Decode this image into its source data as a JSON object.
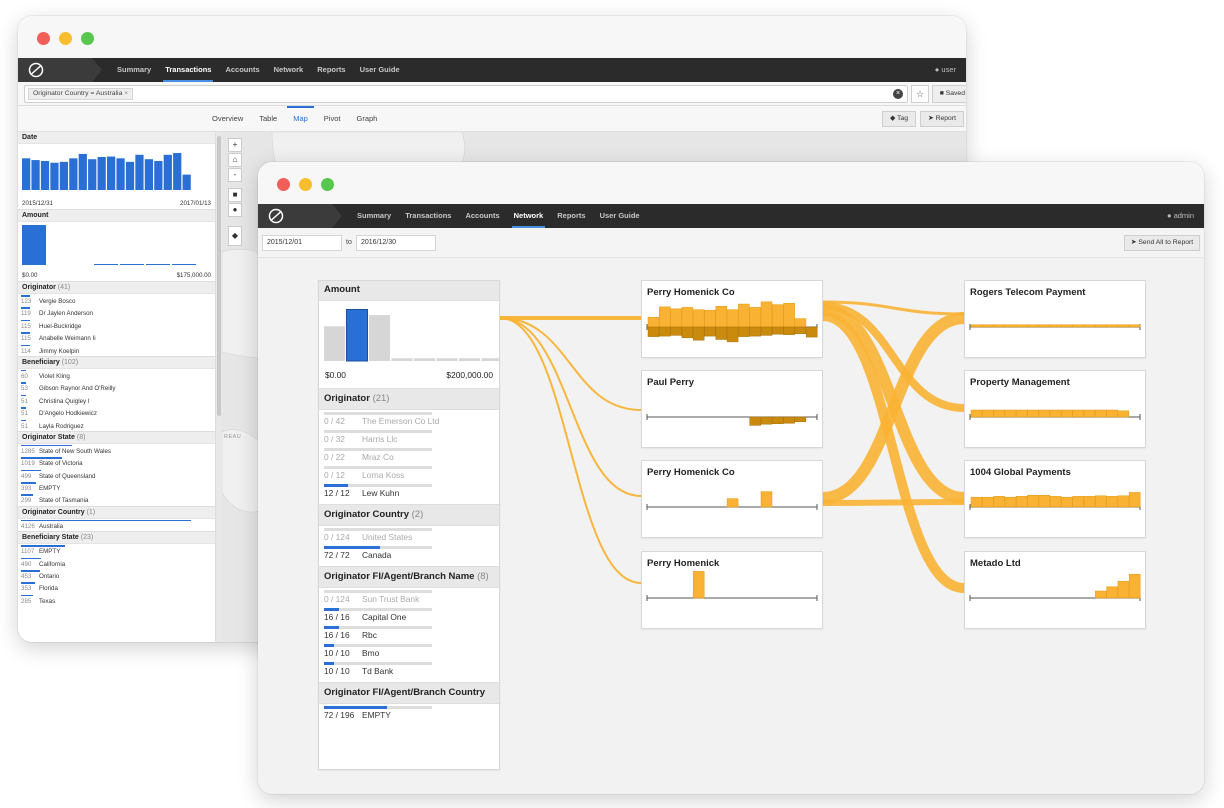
{
  "colors": {
    "accent": "#2a6fd6",
    "flow": "#f9b233",
    "flow_dark": "#c98a0e",
    "nav_bg": "#2b2b2b"
  },
  "back_window": {
    "nav": {
      "tabs": [
        "Summary",
        "Transactions",
        "Accounts",
        "Network",
        "Reports",
        "User Guide"
      ],
      "active": "Transactions",
      "user": "user"
    },
    "filter": {
      "chip": "Originator Country = Australia",
      "saved_label": "Saved"
    },
    "view_tabs": [
      "Overview",
      "Table",
      "Map",
      "Pivot",
      "Graph"
    ],
    "active_view": "Map",
    "tag_label": "Tag",
    "report_label": "Report",
    "sidebar": {
      "date": {
        "title": "Date",
        "start": "2015/12/31",
        "end": "2017/01/13",
        "bars": [
          0.72,
          0.68,
          0.66,
          0.62,
          0.64,
          0.72,
          0.82,
          0.7,
          0.75,
          0.76,
          0.72,
          0.64,
          0.8,
          0.7,
          0.66,
          0.8,
          0.84,
          0.35
        ]
      },
      "amount": {
        "title": "Amount",
        "min": "$0.00",
        "max": "$175,000.00"
      },
      "originator": {
        "title": "Originator",
        "count": "(41)",
        "rows": [
          {
            "n": "123",
            "name": "Vergie Bosco",
            "f": 0.05
          },
          {
            "n": "119",
            "name": "Dr Jaylen Anderson",
            "f": 0.05
          },
          {
            "n": "115",
            "name": "Huel-Buckridge",
            "f": 0.05
          },
          {
            "n": "115",
            "name": "Anabelle Weimann Ii",
            "f": 0.05
          },
          {
            "n": "114",
            "name": "Jimmy Koelpin",
            "f": 0.05
          }
        ]
      },
      "beneficiary": {
        "title": "Beneficiary",
        "count": "(102)",
        "rows": [
          {
            "n": "60",
            "name": "Violet Kling",
            "f": 0.03
          },
          {
            "n": "53",
            "name": "Gibson Raynor And O'Reilly",
            "f": 0.03
          },
          {
            "n": "51",
            "name": "Christina Quigley I",
            "f": 0.03
          },
          {
            "n": "51",
            "name": "D'Angelo Hodkiewicz",
            "f": 0.03
          },
          {
            "n": "51",
            "name": "Layla Rodriguez",
            "f": 0.03
          }
        ]
      },
      "orig_state": {
        "title": "Originator State",
        "count": "(8)",
        "rows": [
          {
            "n": "1285",
            "name": "State of New South Wales",
            "f": 0.3
          },
          {
            "n": "1019",
            "name": "State of Victoria",
            "f": 0.24
          },
          {
            "n": "499",
            "name": "State of Queensland",
            "f": 0.12
          },
          {
            "n": "393",
            "name": "EMPTY",
            "f": 0.09
          },
          {
            "n": "299",
            "name": "State of Tasmania",
            "f": 0.07
          }
        ]
      },
      "orig_country": {
        "title": "Originator Country",
        "count": "(1)",
        "rows": [
          {
            "n": "4126",
            "name": "Australia",
            "f": 1.0
          }
        ]
      },
      "ben_state": {
        "title": "Beneficiary State",
        "count": "(23)",
        "rows": [
          {
            "n": "1107",
            "name": "EMPTY",
            "f": 0.26
          },
          {
            "n": "490",
            "name": "California",
            "f": 0.12
          },
          {
            "n": "453",
            "name": "Ontario",
            "f": 0.11
          },
          {
            "n": "353",
            "name": "Florida",
            "f": 0.08
          },
          {
            "n": "285",
            "name": "Texas",
            "f": 0.07
          }
        ]
      }
    },
    "map": {
      "label": "REAU"
    }
  },
  "front_window": {
    "nav": {
      "tabs": [
        "Summary",
        "Transactions",
        "Accounts",
        "Network",
        "Reports",
        "User Guide"
      ],
      "active": "Network",
      "user": "admin"
    },
    "date_from": "2015/12/01",
    "date_to_label": "to",
    "date_to": "2016/12/30",
    "send_label": "Send All to Report",
    "filters": {
      "amount": {
        "title": "Amount",
        "min": "$0.00",
        "max": "$200,000.00",
        "bars": [
          0.62,
          0.92,
          0.82,
          0.05,
          0.05,
          0.05,
          0.05,
          0.05
        ],
        "selected_index": 1
      },
      "originator": {
        "title": "Originator",
        "count": "(21)",
        "rows": [
          {
            "n": "0 / 42",
            "name": "The Emerson Co Ltd",
            "f": 0.0,
            "dim": true
          },
          {
            "n": "0 / 32",
            "name": "Harris Llc",
            "f": 0.0,
            "dim": true
          },
          {
            "n": "0 / 22",
            "name": "Mraz Co",
            "f": 0.0,
            "dim": true
          },
          {
            "n": "0 / 12",
            "name": "Lorna Koss",
            "f": 0.0,
            "dim": true
          },
          {
            "n": "12 / 12",
            "name": "Lew Kuhn",
            "f": 0.14,
            "dim": false
          }
        ]
      },
      "orig_country": {
        "title": "Originator Country",
        "count": "(2)",
        "rows": [
          {
            "n": "0 / 124",
            "name": "United States",
            "f": 0.0,
            "dim": true
          },
          {
            "n": "72 / 72",
            "name": "Canada",
            "f": 0.33,
            "dim": false
          }
        ]
      },
      "orig_fi": {
        "title": "Originator FI/Agent/Branch Name",
        "count": "(8)",
        "rows": [
          {
            "n": "0 / 124",
            "name": "Sun Trust Bank",
            "f": 0.0,
            "dim": true
          },
          {
            "n": "16 / 16",
            "name": "Capital One",
            "f": 0.09,
            "dim": false
          },
          {
            "n": "16 / 16",
            "name": "Rbc",
            "f": 0.09,
            "dim": false
          },
          {
            "n": "10 / 10",
            "name": "Bmo",
            "f": 0.06,
            "dim": false
          },
          {
            "n": "10 / 10",
            "name": "Td Bank",
            "f": 0.06,
            "dim": false
          }
        ]
      },
      "orig_fi_country": {
        "title": "Originator FI/Agent/Branch Country",
        "rows": [
          {
            "n": "72 / 196",
            "name": "EMPTY",
            "f": 0.37,
            "dim": false
          }
        ]
      }
    },
    "middle_nodes": [
      {
        "name": "Perry Homenick Co",
        "up": [
          0.35,
          0.72,
          0.65,
          0.7,
          0.62,
          0.6,
          0.74,
          0.62,
          0.82,
          0.7,
          0.9,
          0.8,
          0.85,
          0.3,
          0.0
        ],
        "down": [
          0.4,
          0.38,
          0.35,
          0.45,
          0.55,
          0.38,
          0.52,
          0.62,
          0.4,
          0.38,
          0.35,
          0.3,
          0.32,
          0.28,
          0.42
        ]
      },
      {
        "name": "Paul Perry",
        "up": [
          0,
          0,
          0,
          0,
          0,
          0,
          0,
          0,
          0,
          0,
          0,
          0,
          0,
          0,
          0
        ],
        "down": [
          0,
          0,
          0,
          0,
          0,
          0,
          0,
          0,
          0,
          0.35,
          0.3,
          0.28,
          0.26,
          0.2,
          0
        ]
      },
      {
        "name": "Perry Homenick Co",
        "up": [
          0,
          0,
          0,
          0,
          0,
          0,
          0,
          0.3,
          0,
          0,
          0.55,
          0,
          0,
          0,
          0
        ],
        "down": [
          0,
          0,
          0,
          0,
          0,
          0,
          0,
          0,
          0,
          0,
          0,
          0,
          0,
          0,
          0
        ]
      },
      {
        "name": "Perry Homenick",
        "up": [
          0,
          0,
          0,
          0,
          0.95,
          0,
          0,
          0,
          0,
          0,
          0,
          0,
          0,
          0,
          0
        ],
        "down": [
          0,
          0,
          0,
          0,
          0,
          0,
          0,
          0,
          0,
          0,
          0,
          0,
          0,
          0,
          0
        ]
      }
    ],
    "right_nodes": [
      {
        "name": "Rogers Telecom Payment",
        "up": [
          0.08,
          0.08,
          0.08,
          0.08,
          0.08,
          0.08,
          0.08,
          0.08,
          0.08,
          0.08,
          0.08,
          0.08,
          0.08,
          0.08,
          0.08
        ]
      },
      {
        "name": "Property Management",
        "up": [
          0.25,
          0.25,
          0.25,
          0.25,
          0.25,
          0.25,
          0.25,
          0.25,
          0.25,
          0.25,
          0.25,
          0.25,
          0.25,
          0.22,
          0
        ]
      },
      {
        "name": "1004 Global Payments",
        "up": [
          0.35,
          0.35,
          0.38,
          0.35,
          0.38,
          0.42,
          0.42,
          0.38,
          0.35,
          0.38,
          0.38,
          0.4,
          0.38,
          0.4,
          0.52
        ]
      },
      {
        "name": "Metado Ltd",
        "up": [
          0,
          0,
          0,
          0,
          0,
          0,
          0,
          0,
          0,
          0,
          0,
          0.25,
          0.4,
          0.6,
          0.85
        ]
      }
    ]
  }
}
